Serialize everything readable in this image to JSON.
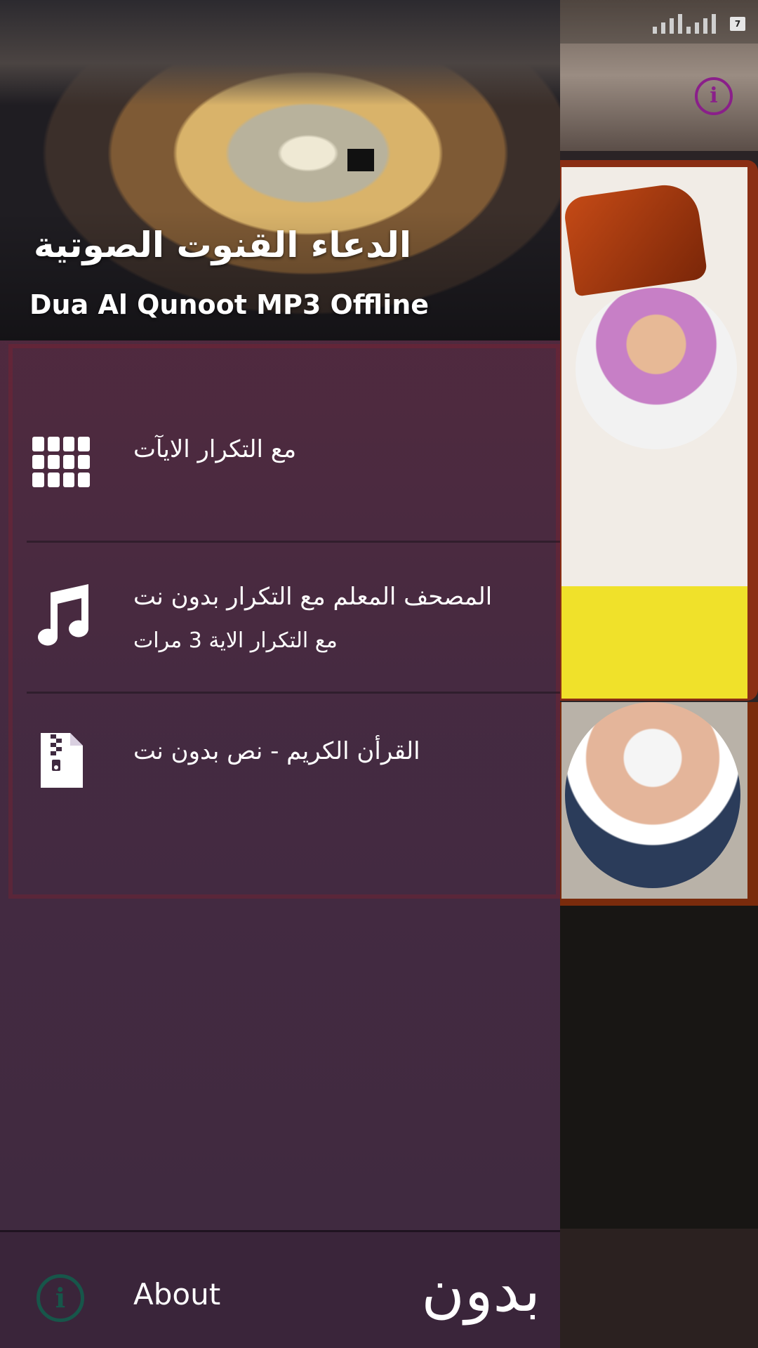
{
  "drawer": {
    "header": {
      "title_ar": "الدعاء القنوت الصوتية",
      "title_en": "Dua Al Qunoot MP3 Offline"
    },
    "items": [
      {
        "label": "مع التكرار الايآت",
        "sublabel": "",
        "icon": "grid-icon"
      },
      {
        "label": "المصحف المعلم مع التكرار بدون نت",
        "sublabel": "مع التكرار الاية 3 مرات",
        "icon": "music-note-icon"
      },
      {
        "label": "القرأن الكريم - نص بدون نت",
        "sublabel": "",
        "icon": "zip-file-icon"
      }
    ],
    "footer": {
      "about_label": "About",
      "about_icon": "info-icon",
      "arabic_text": "بدون نت"
    }
  },
  "status_bar": {
    "battery": "7"
  },
  "colors": {
    "drawer_bg": "#3f2a40",
    "about_icon": "#17564a",
    "info_button": "#8a1f8a"
  }
}
